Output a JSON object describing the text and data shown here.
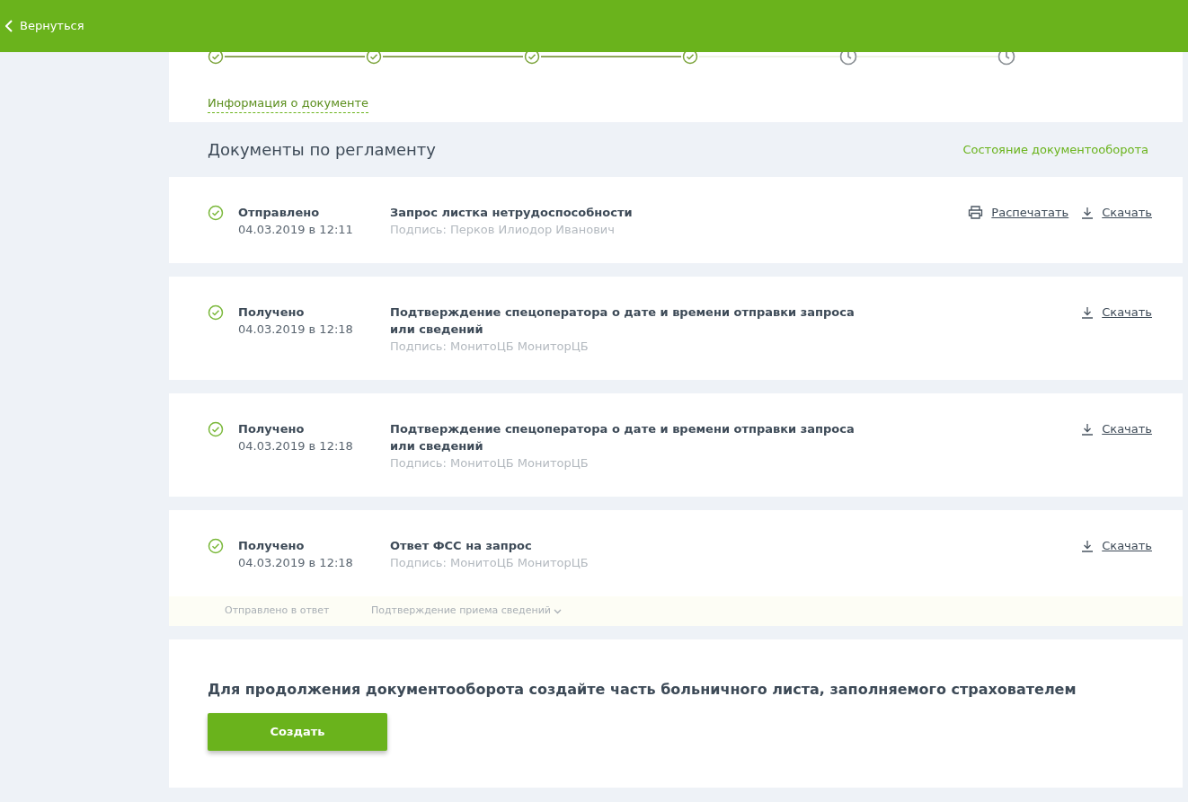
{
  "header": {
    "back_label": "Вернуться"
  },
  "stepper": {
    "steps": [
      {
        "done": true
      },
      {
        "done": true
      },
      {
        "done": true
      },
      {
        "done": true
      },
      {
        "done": false
      },
      {
        "done": false
      }
    ],
    "info_link": "Информация о документе"
  },
  "documents": {
    "title": "Документы по регламенту",
    "state_link": "Состояние документооборота",
    "items": [
      {
        "status": "Отправлено",
        "date": "04.03.2019 в 12:11",
        "title": "Запрос листка нетрудоспособности",
        "signature": "Подпись: Перков Илиодор Иванович",
        "actions": [
          {
            "kind": "print",
            "label": "Распечатать"
          },
          {
            "kind": "download",
            "label": "Скачать"
          }
        ]
      },
      {
        "status": "Получено",
        "date": "04.03.2019 в 12:18",
        "title": "Подтверждение спецоператора о дате и времени отправки запроса или сведений",
        "signature": "Подпись: МонитоЦБ МониторЦБ",
        "actions": [
          {
            "kind": "download",
            "label": "Скачать"
          }
        ]
      },
      {
        "status": "Получено",
        "date": "04.03.2019 в 12:18",
        "title": "Подтверждение спецоператора о дате и времени отправки запроса или сведений",
        "signature": "Подпись: МонитоЦБ МониторЦБ",
        "actions": [
          {
            "kind": "download",
            "label": "Скачать"
          }
        ]
      },
      {
        "status": "Получено",
        "date": "04.03.2019 в 12:18",
        "title": "Ответ ФСС на запрос",
        "signature": "Подпись: МонитоЦБ МониторЦБ",
        "actions": [
          {
            "kind": "download",
            "label": "Скачать"
          }
        ],
        "reply": {
          "label": "Отправлено в ответ",
          "link": "Подтверждение приема сведений",
          "expanded": false
        }
      }
    ]
  },
  "create": {
    "message": "Для продолжения документооборота создайте часть больничного листа, заполняемого страхователем",
    "button": "Создать"
  }
}
